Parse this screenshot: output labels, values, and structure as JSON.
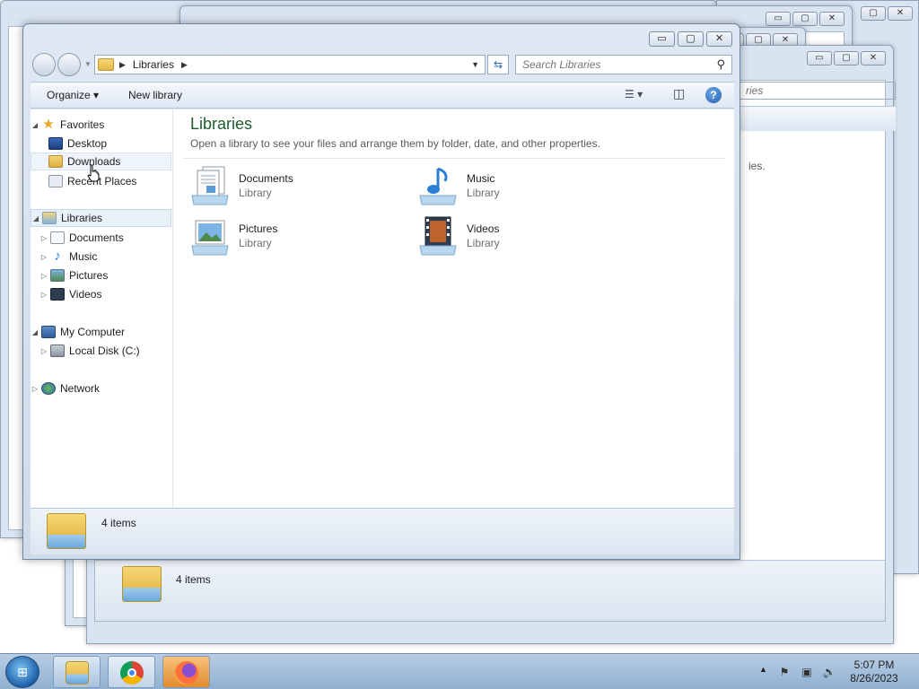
{
  "window": {
    "caption_buttons": {
      "minimize": "▭",
      "maximize": "▢",
      "close": "✕"
    },
    "address_bar": {
      "crumbs": [
        "Libraries"
      ]
    },
    "search": {
      "placeholder": "Search Libraries"
    },
    "toolbar": {
      "organize": "Organize ▾",
      "new_library": "New library",
      "help": "?"
    }
  },
  "nav": {
    "favorites": {
      "label": "Favorites",
      "items": [
        "Desktop",
        "Downloads",
        "Recent Places"
      ]
    },
    "libraries": {
      "label": "Libraries",
      "items": [
        "Documents",
        "Music",
        "Pictures",
        "Videos"
      ]
    },
    "computer": {
      "label": "My Computer",
      "items": [
        "Local Disk (C:)"
      ]
    },
    "network": {
      "label": "Network"
    }
  },
  "content": {
    "title": "Libraries",
    "description": "Open a library to see your files and arrange them by folder, date, and other properties.",
    "libraries": [
      {
        "name": "Documents",
        "type": "Library",
        "icon": "documents-library-icon"
      },
      {
        "name": "Music",
        "type": "Library",
        "icon": "music-library-icon"
      },
      {
        "name": "Pictures",
        "type": "Library",
        "icon": "pictures-library-icon"
      },
      {
        "name": "Videos",
        "type": "Library",
        "icon": "videos-library-icon"
      }
    ]
  },
  "details": {
    "count": "4 items"
  },
  "background_window": {
    "count": "4 items",
    "partial_text": [
      "ries",
      "ies."
    ]
  },
  "taskbar": {
    "pinned": [
      "windows-explorer",
      "google-chrome",
      "firefox"
    ],
    "clock": {
      "time": "5:07 PM",
      "date": "8/26/2023"
    }
  },
  "colors": {
    "title": "#1e5b2e",
    "taskbar": "#a9c2de",
    "window_chrome": "#d9e4f1"
  }
}
